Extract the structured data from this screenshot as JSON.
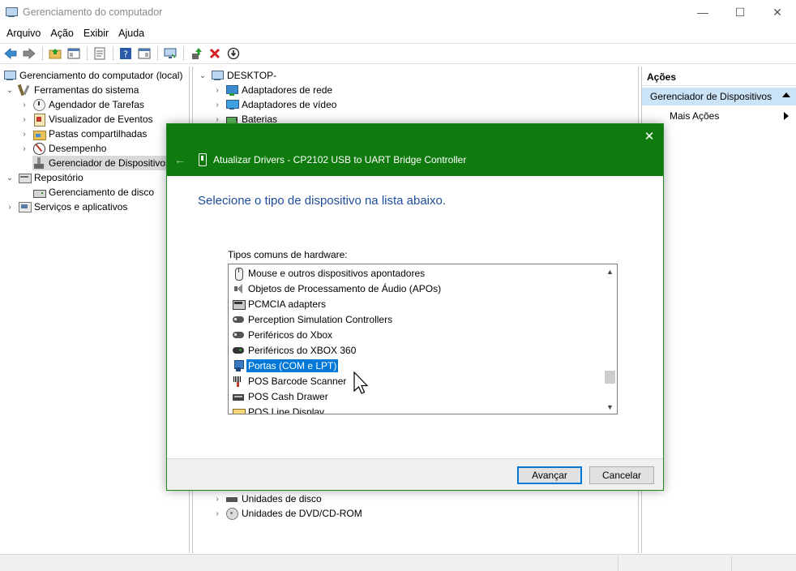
{
  "window": {
    "title": "Gerenciamento do computador",
    "minimize": "—",
    "maximize": "☐",
    "close": "✕"
  },
  "menu": [
    "Arquivo",
    "Ação",
    "Exibir",
    "Ajuda"
  ],
  "toolbar": {
    "icons": [
      "back-arrow-icon",
      "forward-arrow-icon",
      "up-folder-icon",
      "show-hide-tree-icon",
      "properties-icon",
      "help-icon",
      "help-topic-icon",
      "monitor-icon",
      "update-driver-icon",
      "uninstall-icon",
      "disable-icon"
    ]
  },
  "left_tree": [
    {
      "label": "Gerenciamento do computador (local)",
      "icon": "computer-icon",
      "chev": "",
      "level": 0
    },
    {
      "label": "Ferramentas do sistema",
      "icon": "tools-icon",
      "chev": "expanded",
      "level": 1
    },
    {
      "label": "Agendador de Tarefas",
      "icon": "clock-icon",
      "chev": "collapsed",
      "level": 2
    },
    {
      "label": "Visualizador de Eventos",
      "icon": "event-viewer-icon",
      "chev": "collapsed",
      "level": 2
    },
    {
      "label": "Pastas compartilhadas",
      "icon": "shared-folder-icon",
      "chev": "collapsed",
      "level": 2
    },
    {
      "label": "Desempenho",
      "icon": "performance-icon",
      "chev": "collapsed",
      "level": 2
    },
    {
      "label": "Gerenciador de Dispositivos",
      "icon": "device-manager-icon",
      "chev": "",
      "level": 2,
      "selected": true
    },
    {
      "label": "Repositório",
      "icon": "storage-icon",
      "chev": "expanded",
      "level": 1
    },
    {
      "label": "Gerenciamento de disco",
      "icon": "disk-icon",
      "chev": "",
      "level": 2
    },
    {
      "label": "Serviços e aplicativos",
      "icon": "services-icon",
      "chev": "collapsed",
      "level": 1
    }
  ],
  "mid_tree": {
    "root": "DESKTOP-",
    "top_items": [
      "Adaptadores de rede",
      "Adaptadores de vídeo",
      "Baterias"
    ],
    "bottom_items": [
      "Unidades de disco",
      "Unidades de DVD/CD-ROM"
    ]
  },
  "actions": {
    "header": "Ações",
    "section": "Gerenciador de Dispositivos",
    "more": "Mais Ações"
  },
  "dialog": {
    "title": "Atualizar Drivers - CP2102 USB to UART Bridge Controller",
    "heading": "Selecione o tipo de dispositivo na lista abaixo.",
    "list_label": "Tipos comuns de hardware:",
    "items": [
      {
        "label": "Mouse e outros dispositivos apontadores",
        "icon": "mouse-icon"
      },
      {
        "label": "Objetos de Processamento de Áudio (APOs)",
        "icon": "audio-icon"
      },
      {
        "label": "PCMCIA adapters",
        "icon": "pcmcia-icon"
      },
      {
        "label": "Perception Simulation Controllers",
        "icon": "gamepad-icon"
      },
      {
        "label": "Periféricos do Xbox",
        "icon": "gamepad-icon"
      },
      {
        "label": "Periféricos do XBOX 360",
        "icon": "xbox-controller-icon"
      },
      {
        "label": "Portas (COM e LPT)",
        "icon": "port-icon",
        "selected": true
      },
      {
        "label": "POS Barcode Scanner",
        "icon": "barcode-scanner-icon"
      },
      {
        "label": "POS Cash Drawer",
        "icon": "cash-drawer-icon"
      },
      {
        "label": "POS Line Display",
        "icon": "line-display-icon"
      }
    ],
    "next_button": "Avançar",
    "cancel_button": "Cancelar",
    "close": "✕",
    "back": "←"
  }
}
